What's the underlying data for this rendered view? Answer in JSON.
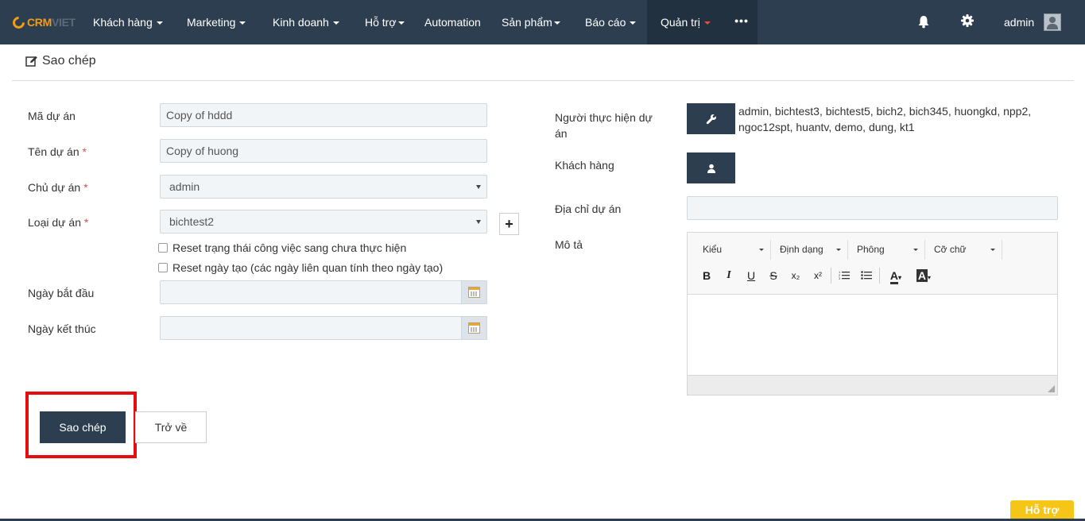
{
  "app": {
    "logo_part1": "CRM",
    "logo_part2": "VIET"
  },
  "nav": {
    "items": [
      {
        "label": "Khách hàng"
      },
      {
        "label": "Marketing"
      },
      {
        "label": "Kinh doanh"
      },
      {
        "label": "Hỗ trợ"
      },
      {
        "label": "Automation"
      },
      {
        "label": "Sản phẩm"
      },
      {
        "label": "Báo cáo"
      },
      {
        "label": "Quản trị"
      }
    ],
    "more": "•••",
    "user": "admin",
    "icons": [
      "bell-icon",
      "gear-icon"
    ],
    "accent_color": "#e74c3c"
  },
  "page": {
    "title": "Sao chép"
  },
  "form": {
    "project_code": {
      "label": "Mã dự án",
      "value": "Copy of hddd"
    },
    "project_name": {
      "label": "Tên dự án",
      "required": "*",
      "value": "Copy of huong"
    },
    "owner": {
      "label": "Chủ dự án",
      "required": "*",
      "value": "admin"
    },
    "project_type": {
      "label": "Loại dự án",
      "required": "*",
      "value": "bichtest2"
    },
    "reset_status": {
      "label": "Reset trạng thái công việc sang chưa thực hiện"
    },
    "reset_date": {
      "label": "Reset ngày tạo (các ngày liên quan tính theo ngày tạo)"
    },
    "start_date": {
      "label": "Ngày bắt đầu",
      "value": ""
    },
    "end_date": {
      "label": "Ngày kết thúc",
      "value": ""
    },
    "assignees": {
      "label": "Người thực hiện dự án",
      "value": "admin, bichtest3, bichtest5, bich2, bich345, huongkd, npp2, ngoc12spt, huantv, demo, dung, kt1"
    },
    "customer": {
      "label": "Khách hàng"
    },
    "address": {
      "label": "Địa chỉ dự án",
      "value": ""
    },
    "description": {
      "label": "Mô tả"
    }
  },
  "editor": {
    "styles": "Kiểu",
    "format": "Định dạng",
    "font": "Phông",
    "size": "Cỡ chữ",
    "buttons": {
      "bold": "B",
      "italic": "I",
      "underline": "U",
      "strike": "S",
      "subscript": "x₂",
      "superscript": "x²",
      "text_color": "A",
      "bg_color": "A"
    }
  },
  "actions": {
    "copy": "Sao chép",
    "back": "Trở về"
  },
  "support": {
    "label": "Hỗ trợ"
  }
}
